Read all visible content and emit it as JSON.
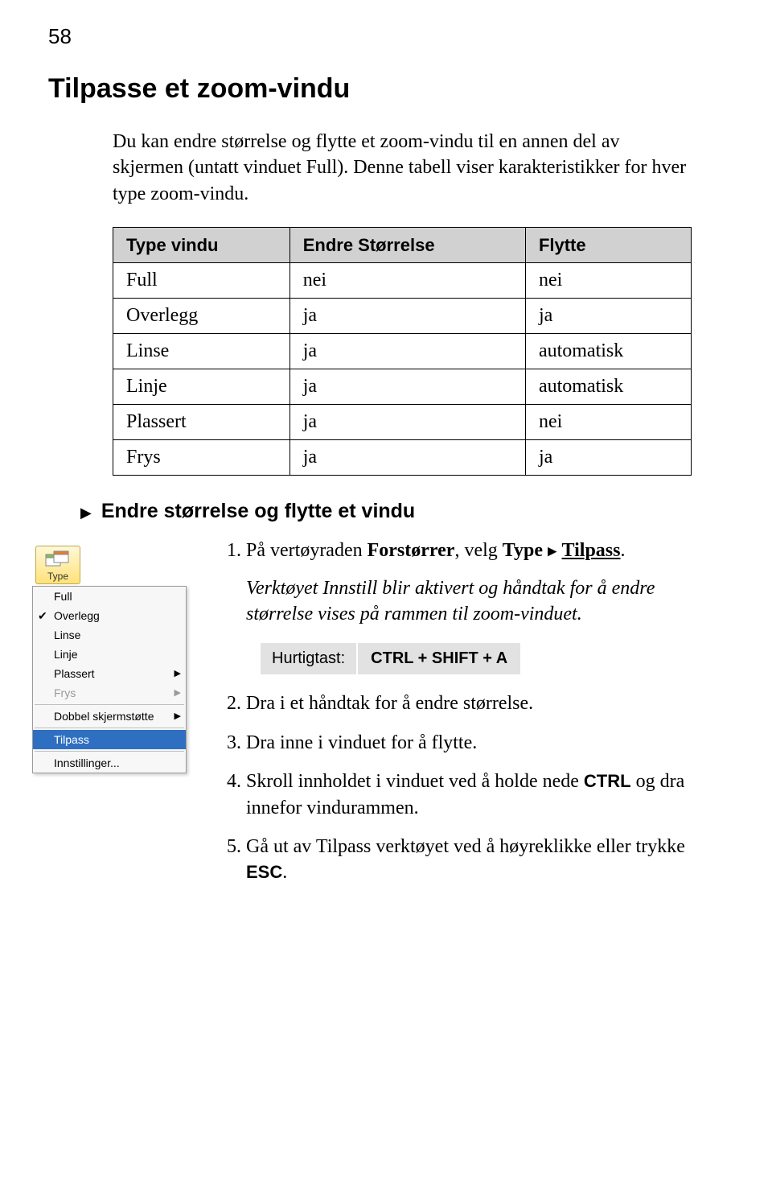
{
  "page_number": "58",
  "title": "Tilpasse et zoom-vindu",
  "intro": "Du kan endre størrelse og flytte et zoom-vindu til en annen del av skjermen (untatt vinduet Full). Denne tabell viser karakteristikker for hver type zoom-vindu.",
  "table": {
    "headers": [
      "Type vindu",
      "Endre Størrelse",
      "Flytte"
    ],
    "rows": [
      [
        "Full",
        "nei",
        "nei"
      ],
      [
        "Overlegg",
        "ja",
        "ja"
      ],
      [
        "Linse",
        "ja",
        "automatisk"
      ],
      [
        "Linje",
        "ja",
        "automatisk"
      ],
      [
        "Plassert",
        "ja",
        "nei"
      ],
      [
        "Frys",
        "ja",
        "ja"
      ]
    ]
  },
  "sub_title": "Endre størrelse og flytte et vindu",
  "dropdown": {
    "button_label": "Type",
    "items": [
      {
        "label": "Full"
      },
      {
        "label": "Overlegg",
        "checked": true
      },
      {
        "label": "Linse"
      },
      {
        "label": "Linje"
      },
      {
        "label": "Plassert",
        "submenu": true
      },
      {
        "label": "Frys",
        "submenu": true,
        "disabled": true
      },
      {
        "sep": true
      },
      {
        "label": "Dobbel skjermstøtte",
        "submenu": true
      },
      {
        "sep": true
      },
      {
        "label": "Tilpass",
        "selected": true
      },
      {
        "sep": true
      },
      {
        "label": "Innstillinger..."
      }
    ]
  },
  "steps": {
    "s1_a": "På vertøyraden ",
    "s1_b": "Forstørrer",
    "s1_c": ", velg ",
    "s1_d": "Type",
    "s1_e": "Tilpass",
    "s1_italic": "Verktøyet Innstill blir aktivert og håndtak for å endre størrelse vises på rammen til zoom-vinduet.",
    "hotkey_label": "Hurtigtast:",
    "hotkey_value": "CTRL + SHIFT + A",
    "s2": "Dra i et håndtak for å endre størrelse.",
    "s3": "Dra inne i vinduet for å flytte.",
    "s4_a": "Skroll innholdet i vinduet ved å holde nede ",
    "s4_b": "CTRL",
    "s4_c": " og dra innefor vindurammen.",
    "s5_a": "Gå ut av Tilpass verktøyet ved å høyreklikke eller trykke ",
    "s5_b": "ESC",
    "s5_c": "."
  }
}
